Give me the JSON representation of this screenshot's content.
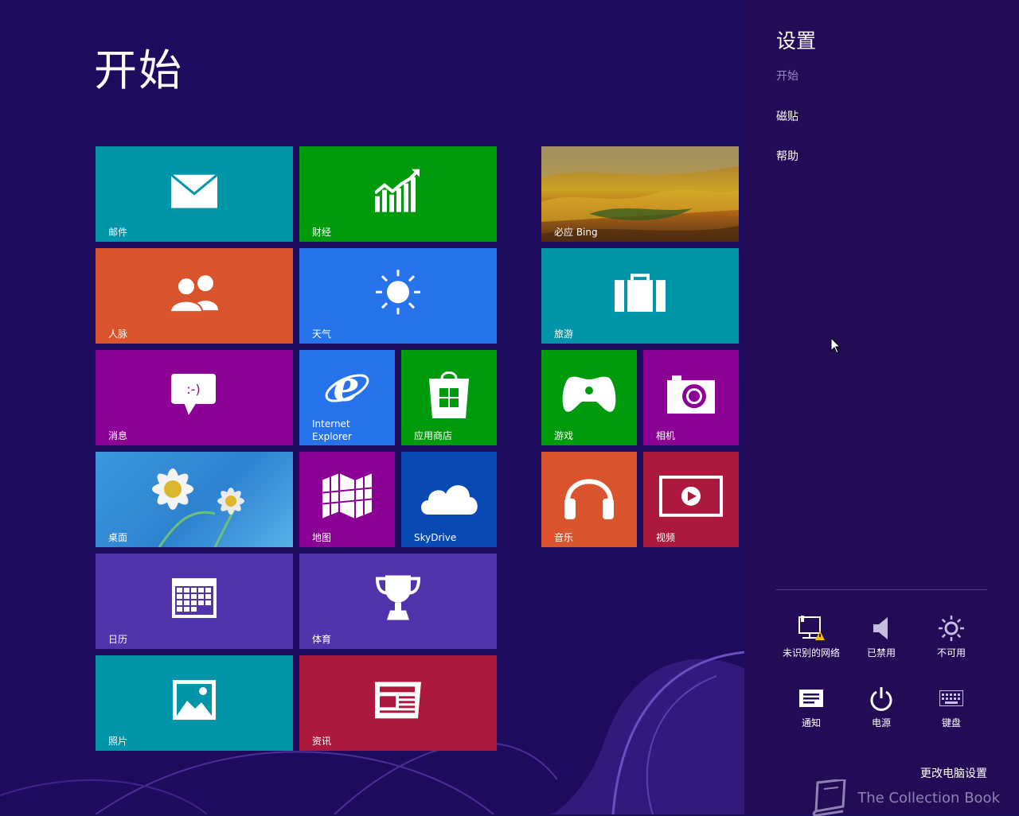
{
  "start": {
    "title": "开始"
  },
  "tiles": {
    "mail": "邮件",
    "finance": "财经",
    "bing": "必应 Bing",
    "people": "人脉",
    "weather": "天气",
    "travel": "旅游",
    "messaging": "消息",
    "ie": "Internet Explorer",
    "store": "应用商店",
    "games": "游戏",
    "camera": "相机",
    "desktop": "桌面",
    "maps": "地图",
    "skydrive": "SkyDrive",
    "music": "音乐",
    "video": "视频",
    "calendar": "日历",
    "sports": "体育",
    "photos": "照片",
    "news": "资讯"
  },
  "settings": {
    "title": "设置",
    "subtitle": "开始",
    "links": [
      "磁贴",
      "帮助"
    ],
    "quick": {
      "network": "未识别的网络",
      "volume": "已禁用",
      "brightness": "不可用",
      "notifications": "通知",
      "power": "电源",
      "keyboard": "键盘"
    },
    "change_pc_settings": "更改电脑设置"
  },
  "watermark": "The Collection Book",
  "colors": {
    "background": "#1e0b5e",
    "panel": "#230b56",
    "teal": "#0095a8",
    "green": "#009b0c",
    "orange": "#d9532c",
    "blue": "#2673ec",
    "purple": "#8c0095",
    "violet": "#5133ab",
    "crimson": "#ac193d"
  }
}
